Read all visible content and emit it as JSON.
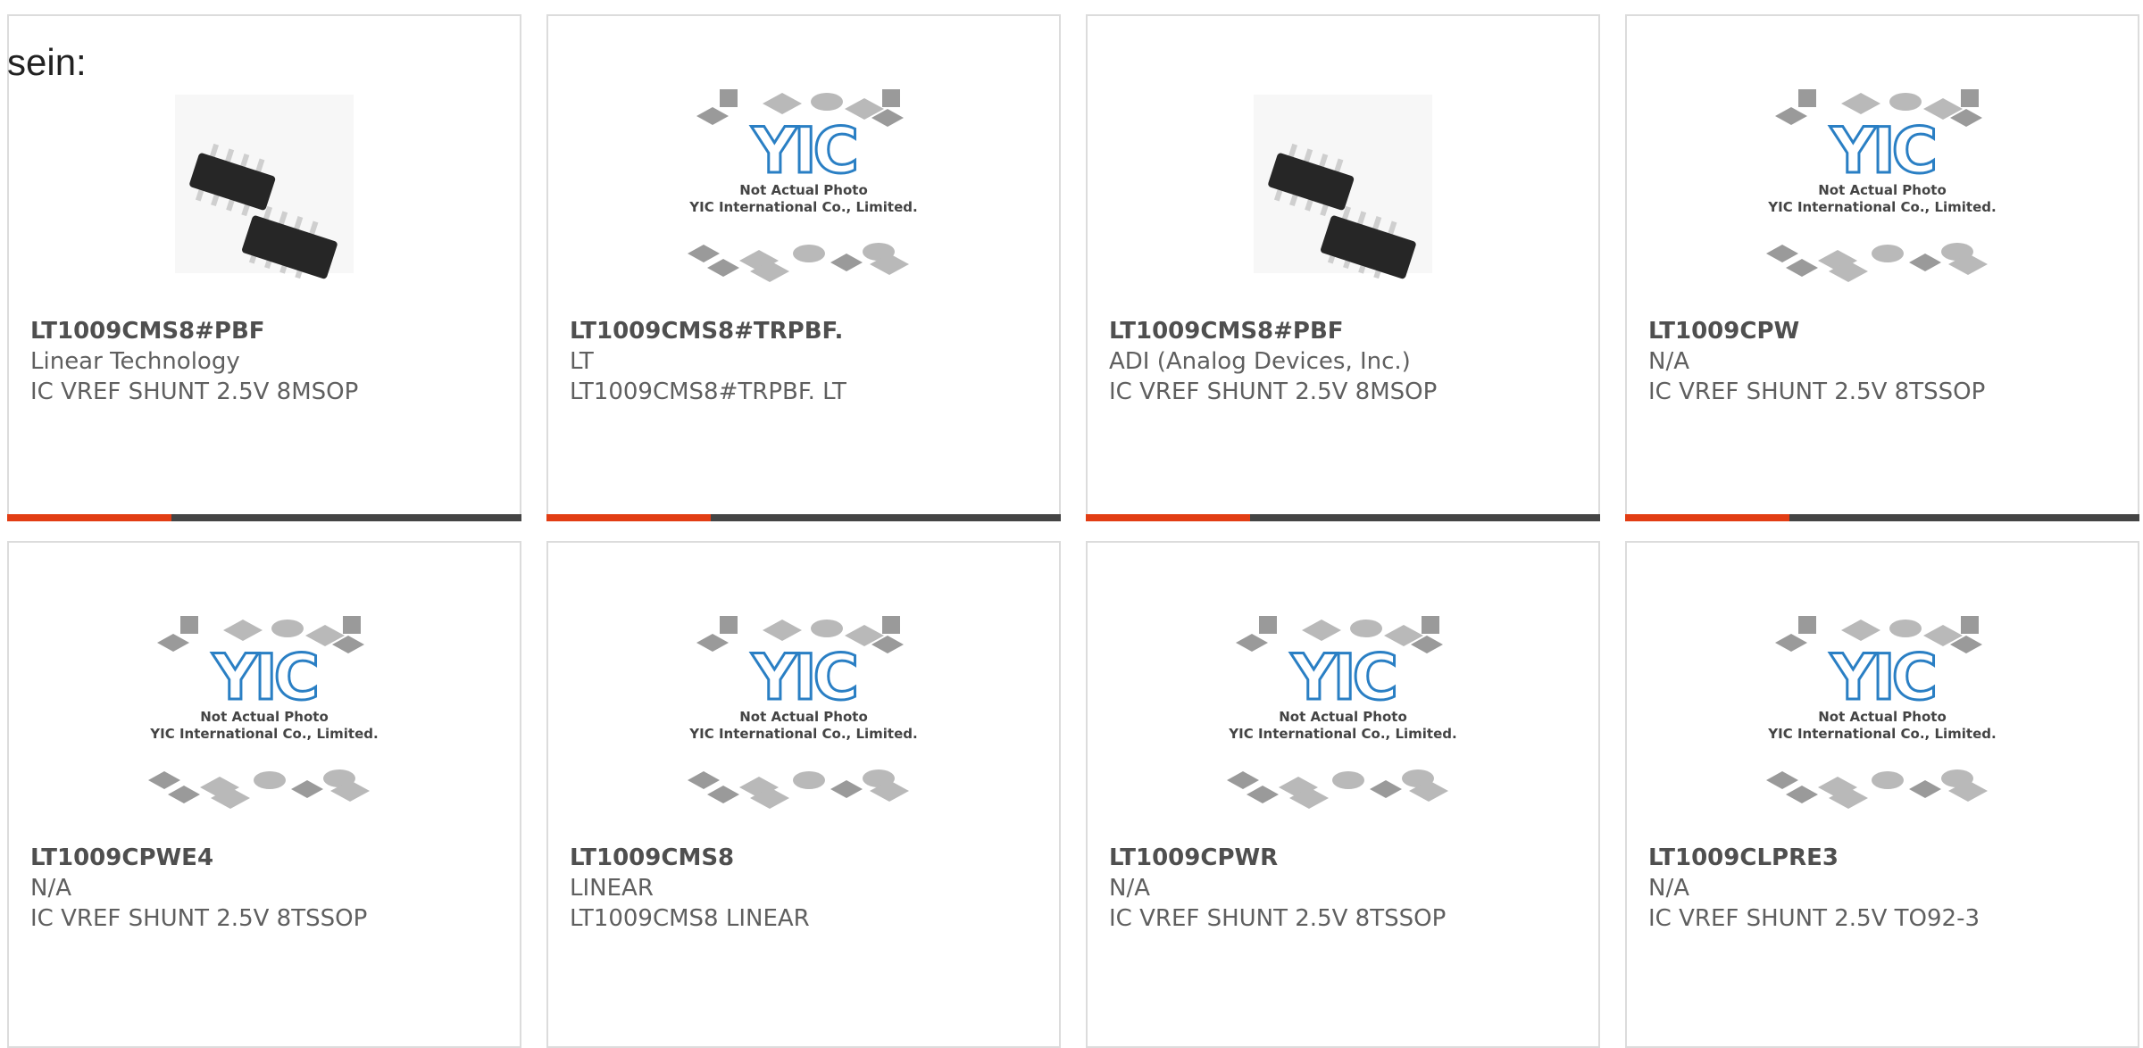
{
  "intro_text": "sein:",
  "products": [
    {
      "part": "LT1009CMS8#PBF",
      "maker": "Linear Technology",
      "description": "IC VREF SHUNT 2.5V 8MSOP",
      "image": "msop-chip-photo",
      "highlighted": true
    },
    {
      "part": "LT1009CMS8#TRPBF.",
      "maker": "LT",
      "description": "LT1009CMS8#TRPBF. LT",
      "image": "yic-placeholder",
      "highlighted": true
    },
    {
      "part": "LT1009CMS8#PBF",
      "maker": "ADI (Analog Devices, Inc.)",
      "description": "IC VREF SHUNT 2.5V 8MSOP",
      "image": "msop-chip-photo",
      "highlighted": true
    },
    {
      "part": "LT1009CPW",
      "maker": "N/A",
      "description": "IC VREF SHUNT 2.5V 8TSSOP",
      "image": "yic-placeholder",
      "highlighted": true
    },
    {
      "part": "LT1009CPWE4",
      "maker": "N/A",
      "description": "IC VREF SHUNT 2.5V 8TSSOP",
      "image": "yic-placeholder",
      "highlighted": false
    },
    {
      "part": "LT1009CMS8",
      "maker": "LINEAR",
      "description": "LT1009CMS8 LINEAR",
      "image": "yic-placeholder",
      "highlighted": false
    },
    {
      "part": "LT1009CPWR",
      "maker": "N/A",
      "description": "IC VREF SHUNT 2.5V 8TSSOP",
      "image": "yic-placeholder",
      "highlighted": false
    },
    {
      "part": "LT1009CLPRE3",
      "maker": "N/A",
      "description": "IC VREF SHUNT 2.5V TO92-3",
      "image": "yic-placeholder",
      "highlighted": false
    }
  ],
  "placeholder_text": {
    "line1": "Not Actual Photo",
    "line2": "YIC International Co., Limited."
  },
  "placeholder_logo": "YIC",
  "colors": {
    "accent": "#e23d14",
    "bar": "#444444",
    "logo_blue": "#2a7fc4"
  }
}
